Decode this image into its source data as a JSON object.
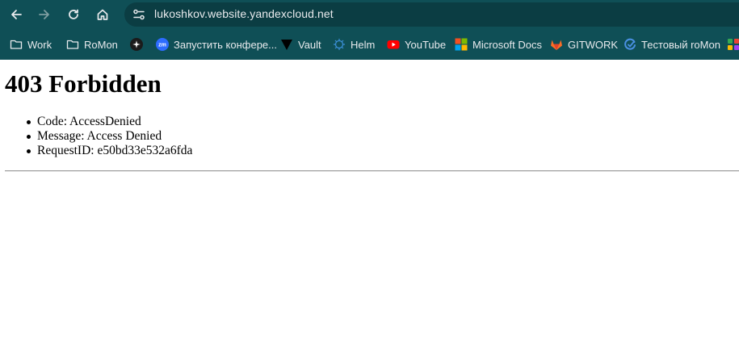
{
  "browser": {
    "address_bar": {
      "url": "lukoshkov.website.yandexcloud.net"
    },
    "nav_icons": [
      "back-arrow-icon",
      "forward-arrow-icon",
      "reload-icon",
      "home-icon",
      "site-info-icon"
    ],
    "bookmarks": [
      {
        "label": "Work",
        "icon": "folder-icon"
      },
      {
        "label": "RoMon",
        "icon": "folder-icon"
      },
      {
        "label": "",
        "icon": "star-app-icon"
      },
      {
        "label": "Запустить конфере...",
        "icon": "zoom-icon"
      },
      {
        "label": "Vault",
        "icon": "vault-triangle-icon"
      },
      {
        "label": "Helm",
        "icon": "helm-icon"
      },
      {
        "label": "YouTube",
        "icon": "youtube-icon"
      },
      {
        "label": "Microsoft Docs",
        "icon": "microsoft-icon"
      },
      {
        "label": "GITWORK",
        "icon": "gitlab-icon"
      },
      {
        "label": "Тестовый roMon",
        "icon": "romon-icon"
      }
    ]
  },
  "page": {
    "heading": "403 Forbidden",
    "details": [
      "Code: AccessDenied",
      "Message: Access Denied",
      "RequestID: e50bd33e532a6fda"
    ]
  },
  "colors": {
    "chrome_background": "#0f4f56",
    "omnibox_background": "#0b3d43",
    "chrome_text": "#e8eaed",
    "page_background": "#ffffff"
  }
}
